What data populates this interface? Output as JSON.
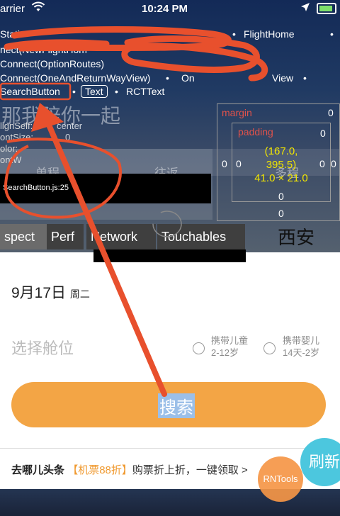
{
  "status_bar": {
    "carrier": "arrier",
    "time": "10:24 PM"
  },
  "hierarchy": [
    {
      "text": "Stati"
    },
    {
      "text": "FlightHome"
    },
    {
      "text": "nect(NewFlightHom"
    },
    {
      "text": "Connect(OptionRoutes)"
    },
    {
      "text": "Connect(OneAndReturnWayView)"
    },
    {
      "text": "On"
    },
    {
      "text": "View"
    }
  ],
  "selected_path": {
    "search_button": "SearchButton",
    "text_node": "Text",
    "rct_text": "RCTText"
  },
  "ghost_text": "那我陪你一起",
  "style_props": [
    "lignSelf:",
    "ontSize:",
    "olor:",
    "ontW"
  ],
  "style_values": {
    "align": "center",
    "size": "0"
  },
  "source_file": "SearchButton.js:25",
  "box_model": {
    "margin_label": "margin",
    "padding_label": "padding",
    "position": "(167.0,",
    "position_y": "395.5)",
    "size": "41.0 × 21.0",
    "margin_top": "0",
    "padding_top": "0",
    "padding_left": "0",
    "margin_left": "0",
    "padding_right": "0",
    "margin_right": "0",
    "padding_bottom": "0",
    "margin_bottom": "0"
  },
  "behind_tabs": {
    "left": "单程",
    "middle": "往返",
    "right": "多程"
  },
  "inspector_tabs": [
    {
      "label": "spect"
    },
    {
      "label": "Perf"
    },
    {
      "label": "Network"
    },
    {
      "label": "Touchables"
    }
  ],
  "city": "西安",
  "date": {
    "day": "9月17日",
    "weekday": "周二"
  },
  "cabin_placeholder": "选择舱位",
  "child_option": {
    "title": "携带儿童",
    "sub": "2-12岁"
  },
  "infant_option": {
    "title": "携带婴儿",
    "sub": "14天-2岁"
  },
  "search_label": "搜索",
  "news": {
    "source": "去哪儿头条",
    "promo": "【机票88折】",
    "text": "购票折上折，一键领取 >"
  },
  "rntools_label": "RNTools",
  "refresh_label": "刷新",
  "colors": {
    "accent_orange": "#f3a545",
    "annotation_red": "#e8502d",
    "refresh_cyan": "#4cc7de",
    "highlight_yellow": "#f2e600"
  }
}
